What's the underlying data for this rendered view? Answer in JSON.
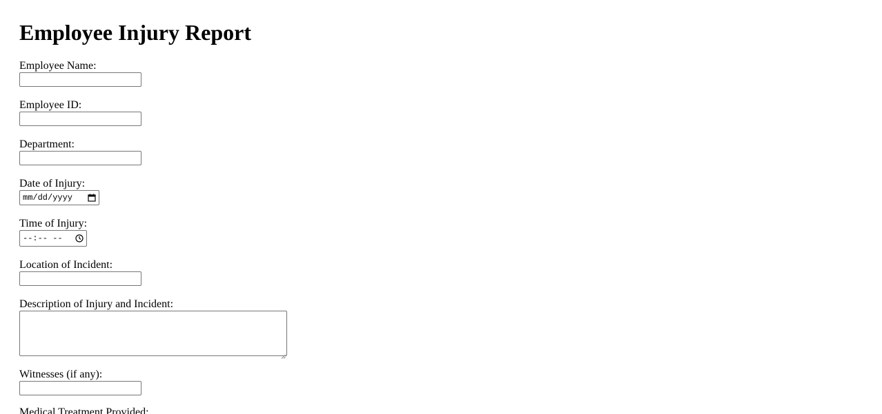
{
  "page": {
    "title": "Employee Injury Report"
  },
  "form": {
    "employee_name_label": "Employee Name:",
    "employee_id_label": "Employee ID:",
    "department_label": "Department:",
    "date_label": "Date of Injury:",
    "date_placeholder": "mm/dd/yyyy",
    "time_label": "Time of Injury:",
    "time_placeholder": "--:-- --",
    "location_label": "Location of Incident:",
    "description_label": "Description of Injury and Incident:",
    "witnesses_label": "Witnesses (if any):",
    "medical_label": "Medical Treatment Provided:"
  },
  "icons": {
    "calendar": "calendar-icon",
    "clock": "clock-icon"
  }
}
